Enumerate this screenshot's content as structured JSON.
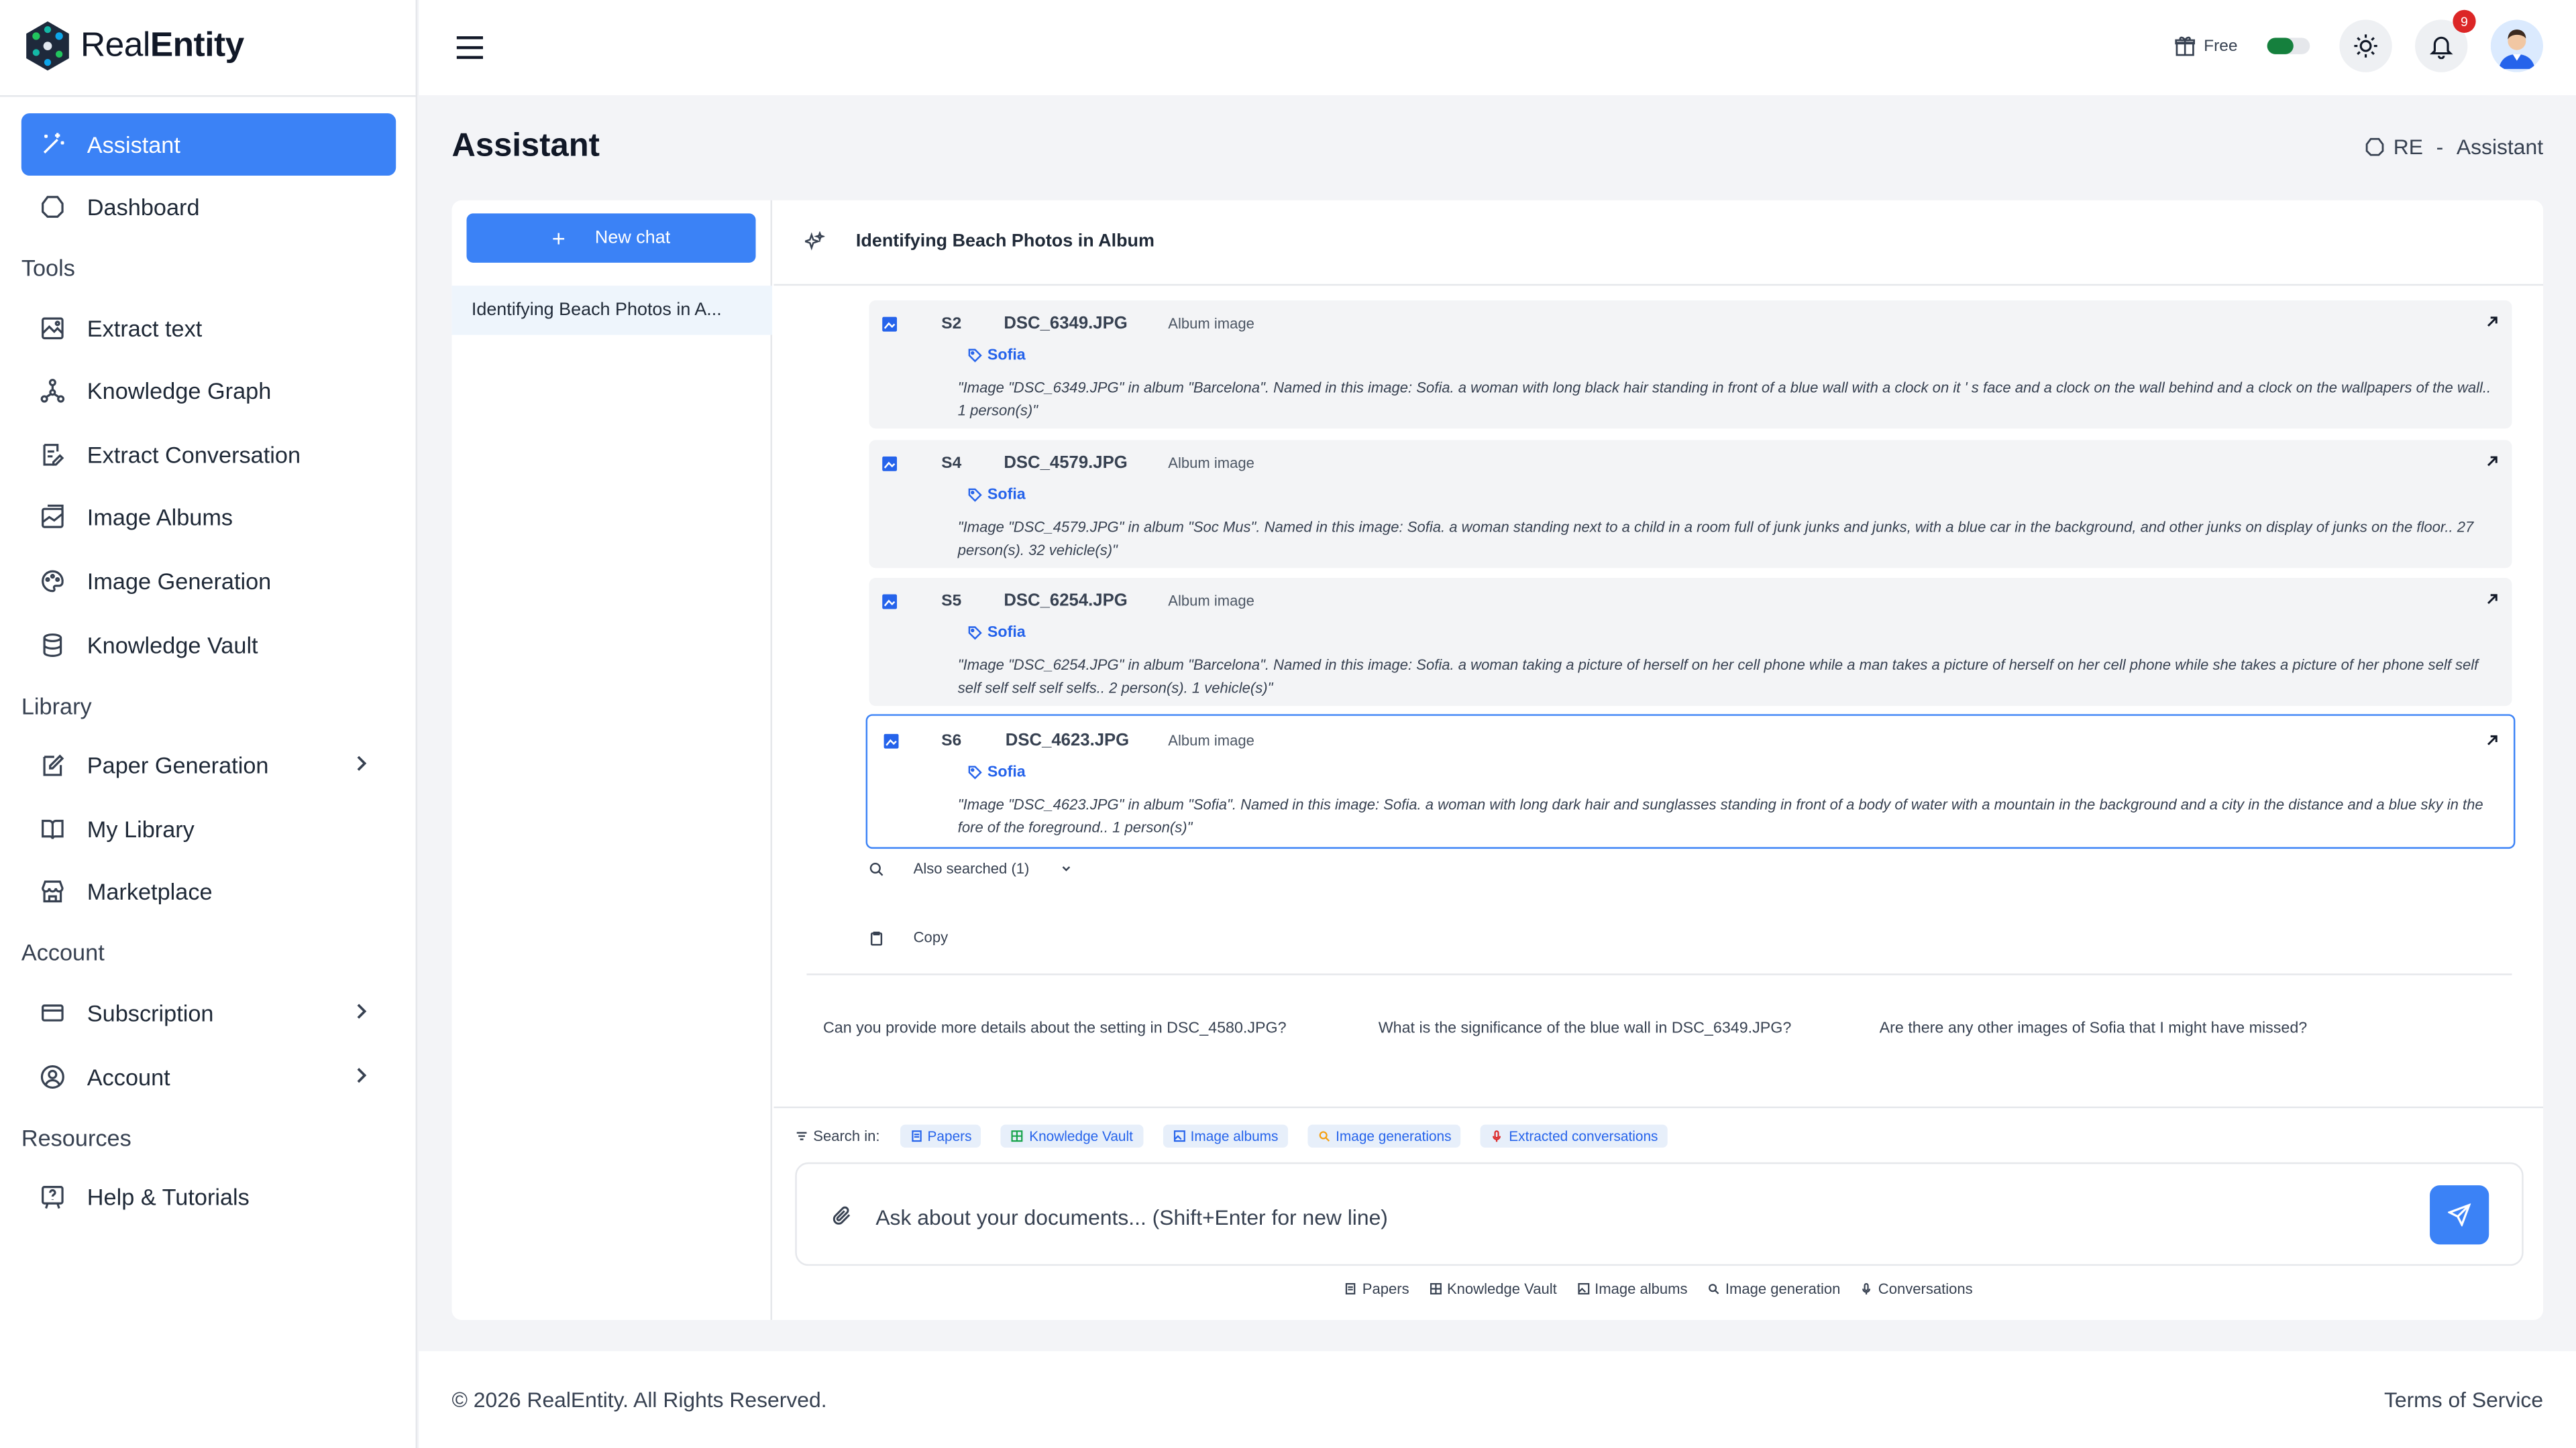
{
  "app": {
    "logo_text_light": "Real",
    "logo_text_bold": "Entity",
    "accent": "#3b82f6"
  },
  "sidebar": {
    "items_top": [
      {
        "label": "Assistant",
        "icon": "magic-wand-icon",
        "active": true
      },
      {
        "label": "Dashboard",
        "icon": "dashboard-icon"
      }
    ],
    "sections": [
      {
        "title": "Tools",
        "items": [
          {
            "label": "Extract text",
            "icon": "image-text-icon"
          },
          {
            "label": "Knowledge Graph",
            "icon": "graph-icon"
          },
          {
            "label": "Extract Conversation",
            "icon": "conversation-icon"
          },
          {
            "label": "Image Albums",
            "icon": "album-icon"
          },
          {
            "label": "Image Generation",
            "icon": "palette-icon"
          },
          {
            "label": "Knowledge Vault",
            "icon": "database-icon"
          }
        ]
      },
      {
        "title": "Library",
        "items": [
          {
            "label": "Paper Generation",
            "icon": "paper-edit-icon"
          },
          {
            "label": "My Library",
            "icon": "book-icon"
          },
          {
            "label": "Marketplace",
            "icon": "store-icon"
          }
        ]
      },
      {
        "title": "Account",
        "items": [
          {
            "label": "Subscription",
            "icon": "card-icon"
          },
          {
            "label": "Account",
            "icon": "user-circle-icon"
          }
        ]
      },
      {
        "title": "Resources",
        "items": [
          {
            "label": "Help & Tutorials",
            "icon": "help-icon"
          }
        ]
      }
    ]
  },
  "topbar": {
    "plan_label": "Free",
    "notifications_count": "9"
  },
  "page": {
    "title": "Assistant",
    "breadcrumb_root": "RE",
    "breadcrumb_sep": "-",
    "breadcrumb_current": "Assistant"
  },
  "chat_list": {
    "new_chat_plus": "+",
    "new_chat_label": "New chat",
    "entries": [
      "Identifying Beach Photos in A..."
    ]
  },
  "chat": {
    "title": "Identifying Beach Photos in Album",
    "sources": [
      {
        "id": "S2",
        "file": "DSC_6349.JPG",
        "type": "Album image",
        "tag": "Sofia",
        "desc": "\"Image \"DSC_6349.JPG\" in album \"Barcelona\". Named in this image: Sofia. a woman with long black hair standing in front of a blue wall with a clock on it ' s face and a clock on the wall behind and a clock on the wallpapers of the wall.. 1 person(s)\""
      },
      {
        "id": "S4",
        "file": "DSC_4579.JPG",
        "type": "Album image",
        "tag": "Sofia",
        "desc": "\"Image \"DSC_4579.JPG\" in album \"Soc Mus\". Named in this image: Sofia. a woman standing next to a child in a room full of junk junks and junks, with a blue car in the background, and other junks on display of junks on the floor.. 27 person(s). 32 vehicle(s)\""
      },
      {
        "id": "S5",
        "file": "DSC_6254.JPG",
        "type": "Album image",
        "tag": "Sofia",
        "desc": "\"Image \"DSC_6254.JPG\" in album \"Barcelona\". Named in this image: Sofia. a woman taking a picture of herself on her cell phone while a man takes a picture of herself on her cell phone while she takes a picture of her phone self self self self self self selfs.. 2 person(s). 1 vehicle(s)\""
      },
      {
        "id": "S6",
        "file": "DSC_4623.JPG",
        "type": "Album image",
        "tag": "Sofia",
        "desc": "\"Image \"DSC_4623.JPG\" in album \"Sofia\". Named in this image: Sofia. a woman with long dark hair and sunglasses standing in front of a body of water with a mountain in the background and a city in the distance and a blue sky in the fore of the foreground.. 1 person(s)\""
      }
    ],
    "also_searched": "Also searched (1)",
    "copy_label": "Copy",
    "suggestions": [
      "Can you provide more details about the setting in DSC_4580.JPG?",
      "What is the significance of the blue wall in DSC_6349.JPG?",
      "Are there any other images of Sofia that I might have missed?"
    ],
    "search_in_label": "Search in:",
    "search_chips": [
      "Papers",
      "Knowledge Vault",
      "Image albums",
      "Image generations",
      "Extracted conversations"
    ],
    "input_placeholder": "Ask about your documents... (Shift+Enter for new line)",
    "legend": [
      "Papers",
      "Knowledge Vault",
      "Image albums",
      "Image generation",
      "Conversations"
    ]
  },
  "footer": {
    "copyright": "© 2026 RealEntity. All Rights Reserved.",
    "terms": "Terms of Service"
  }
}
